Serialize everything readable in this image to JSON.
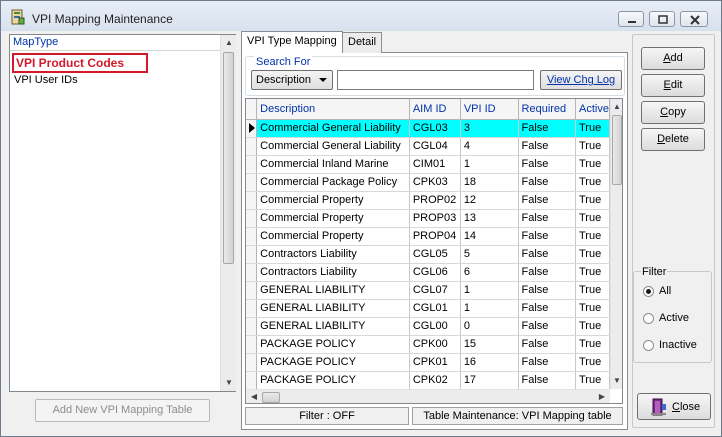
{
  "window": {
    "title": "VPI Mapping Maintenance"
  },
  "left": {
    "header": "MapType",
    "items": [
      "VPI Product Codes",
      "VPI User IDs"
    ],
    "add_button": "Add New VPI Mapping Table"
  },
  "tabs": [
    "VPI Type Mapping",
    "Detail"
  ],
  "search": {
    "label": "Search For",
    "field": "Description",
    "value": "",
    "chglog": "View Chg Log"
  },
  "grid": {
    "columns": [
      "Description",
      "AIM ID",
      "VPI ID",
      "Required",
      "Active"
    ],
    "rows": [
      [
        "Commercial General Liability",
        "CGL03",
        "3",
        "False",
        "True"
      ],
      [
        "Commercial General Liability",
        "CGL04",
        "4",
        "False",
        "True"
      ],
      [
        "Commercial Inland Marine",
        "CIM01",
        "1",
        "False",
        "True"
      ],
      [
        "Commercial Package Policy",
        "CPK03",
        "18",
        "False",
        "True"
      ],
      [
        "Commercial Property",
        "PROP02",
        "12",
        "False",
        "True"
      ],
      [
        "Commercial Property",
        "PROP03",
        "13",
        "False",
        "True"
      ],
      [
        "Commercial Property",
        "PROP04",
        "14",
        "False",
        "True"
      ],
      [
        "Contractors Liability",
        "CGL05",
        "5",
        "False",
        "True"
      ],
      [
        "Contractors Liability",
        "CGL06",
        "6",
        "False",
        "True"
      ],
      [
        "GENERAL LIABILITY",
        "CGL07",
        "1",
        "False",
        "True"
      ],
      [
        "GENERAL LIABILITY",
        "CGL01",
        "1",
        "False",
        "True"
      ],
      [
        "GENERAL LIABILITY",
        "CGL00",
        "0",
        "False",
        "True"
      ],
      [
        "PACKAGE POLICY",
        "CPK00",
        "15",
        "False",
        "True"
      ],
      [
        "PACKAGE POLICY",
        "CPK01",
        "16",
        "False",
        "True"
      ],
      [
        "PACKAGE POLICY",
        "CPK02",
        "17",
        "False",
        "True"
      ]
    ],
    "selected_row": 0
  },
  "status": {
    "filter": "Filter : OFF",
    "maintenance": "Table Maintenance: VPI Mapping table"
  },
  "actions": {
    "add": "Add",
    "edit": "Edit",
    "copy": "Copy",
    "delete": "Delete",
    "close": "Close"
  },
  "filter": {
    "title": "Filter",
    "options": [
      "All",
      "Active",
      "Inactive"
    ],
    "selected": "All"
  },
  "colors": {
    "selected_row": "#00ffff",
    "highlight_border": "#d21a2a",
    "header_text": "#0033aa"
  }
}
